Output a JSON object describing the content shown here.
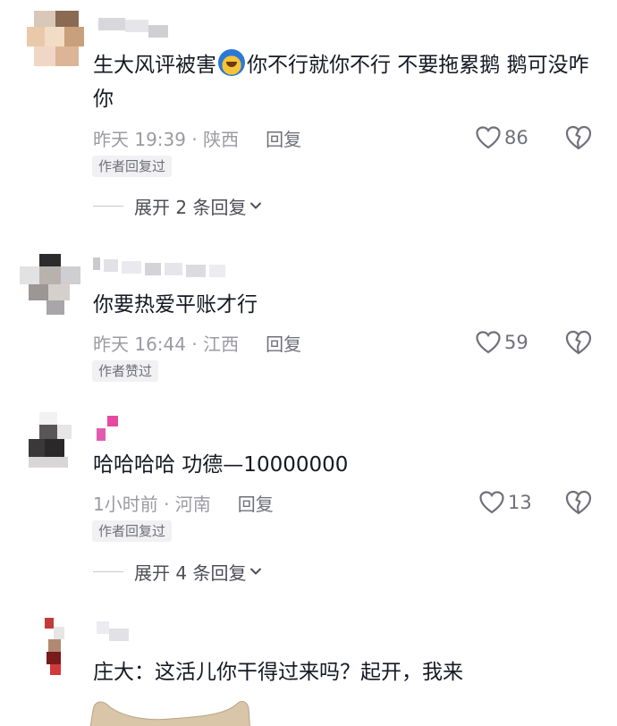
{
  "comments": [
    {
      "text_before": "生大风评被害",
      "text_after": "你不行就你不行 不要拖累鹅 鹅可没咋你",
      "time_location": "昨天 19:39 · 陕西",
      "reply_label": "回复",
      "likes": "86",
      "badge": "作者回复过",
      "expand": "展开 2 条回复"
    },
    {
      "text": "你要热爱平账才行",
      "time_location": "昨天 16:44 · 江西",
      "reply_label": "回复",
      "likes": "59",
      "badge": "作者赞过"
    },
    {
      "text": "哈哈哈哈 功德—10000000",
      "time_location": "1小时前 · 河南",
      "reply_label": "回复",
      "likes": "13",
      "badge": "作者回复过",
      "expand": "展开 4 条回复"
    },
    {
      "text": "庄大：这活儿你干得过来吗？起开，我来"
    }
  ],
  "icons": {
    "like": "heart-outline-icon",
    "dislike": "broken-heart-icon",
    "expand": "chevron-down-icon",
    "emoji": "crying-laughing-emoji-icon"
  },
  "colors": {
    "text": "#161823",
    "meta": "#9a9ba2",
    "badge_bg": "#f1f1f3"
  }
}
